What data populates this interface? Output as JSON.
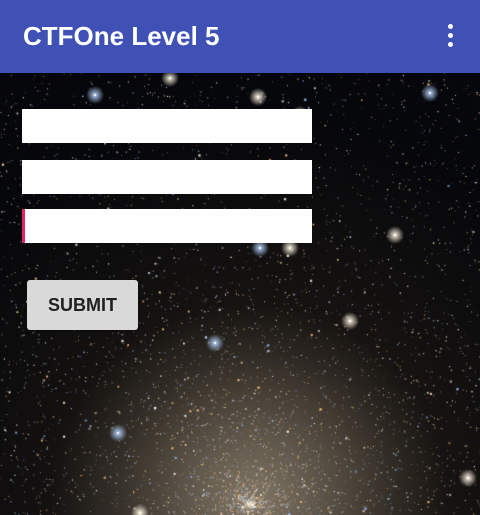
{
  "app_bar": {
    "title": "CTFOne Level 5",
    "menu_icon": "overflow-menu-icon",
    "color": "#3f51b5"
  },
  "form": {
    "fields": [
      {
        "value": "",
        "placeholder": ""
      },
      {
        "value": "",
        "placeholder": ""
      },
      {
        "value": "",
        "placeholder": "",
        "focused": true
      }
    ],
    "submit_label": "SUBMIT"
  },
  "background": {
    "image": "starfield",
    "accent_color": "#e91e63"
  }
}
